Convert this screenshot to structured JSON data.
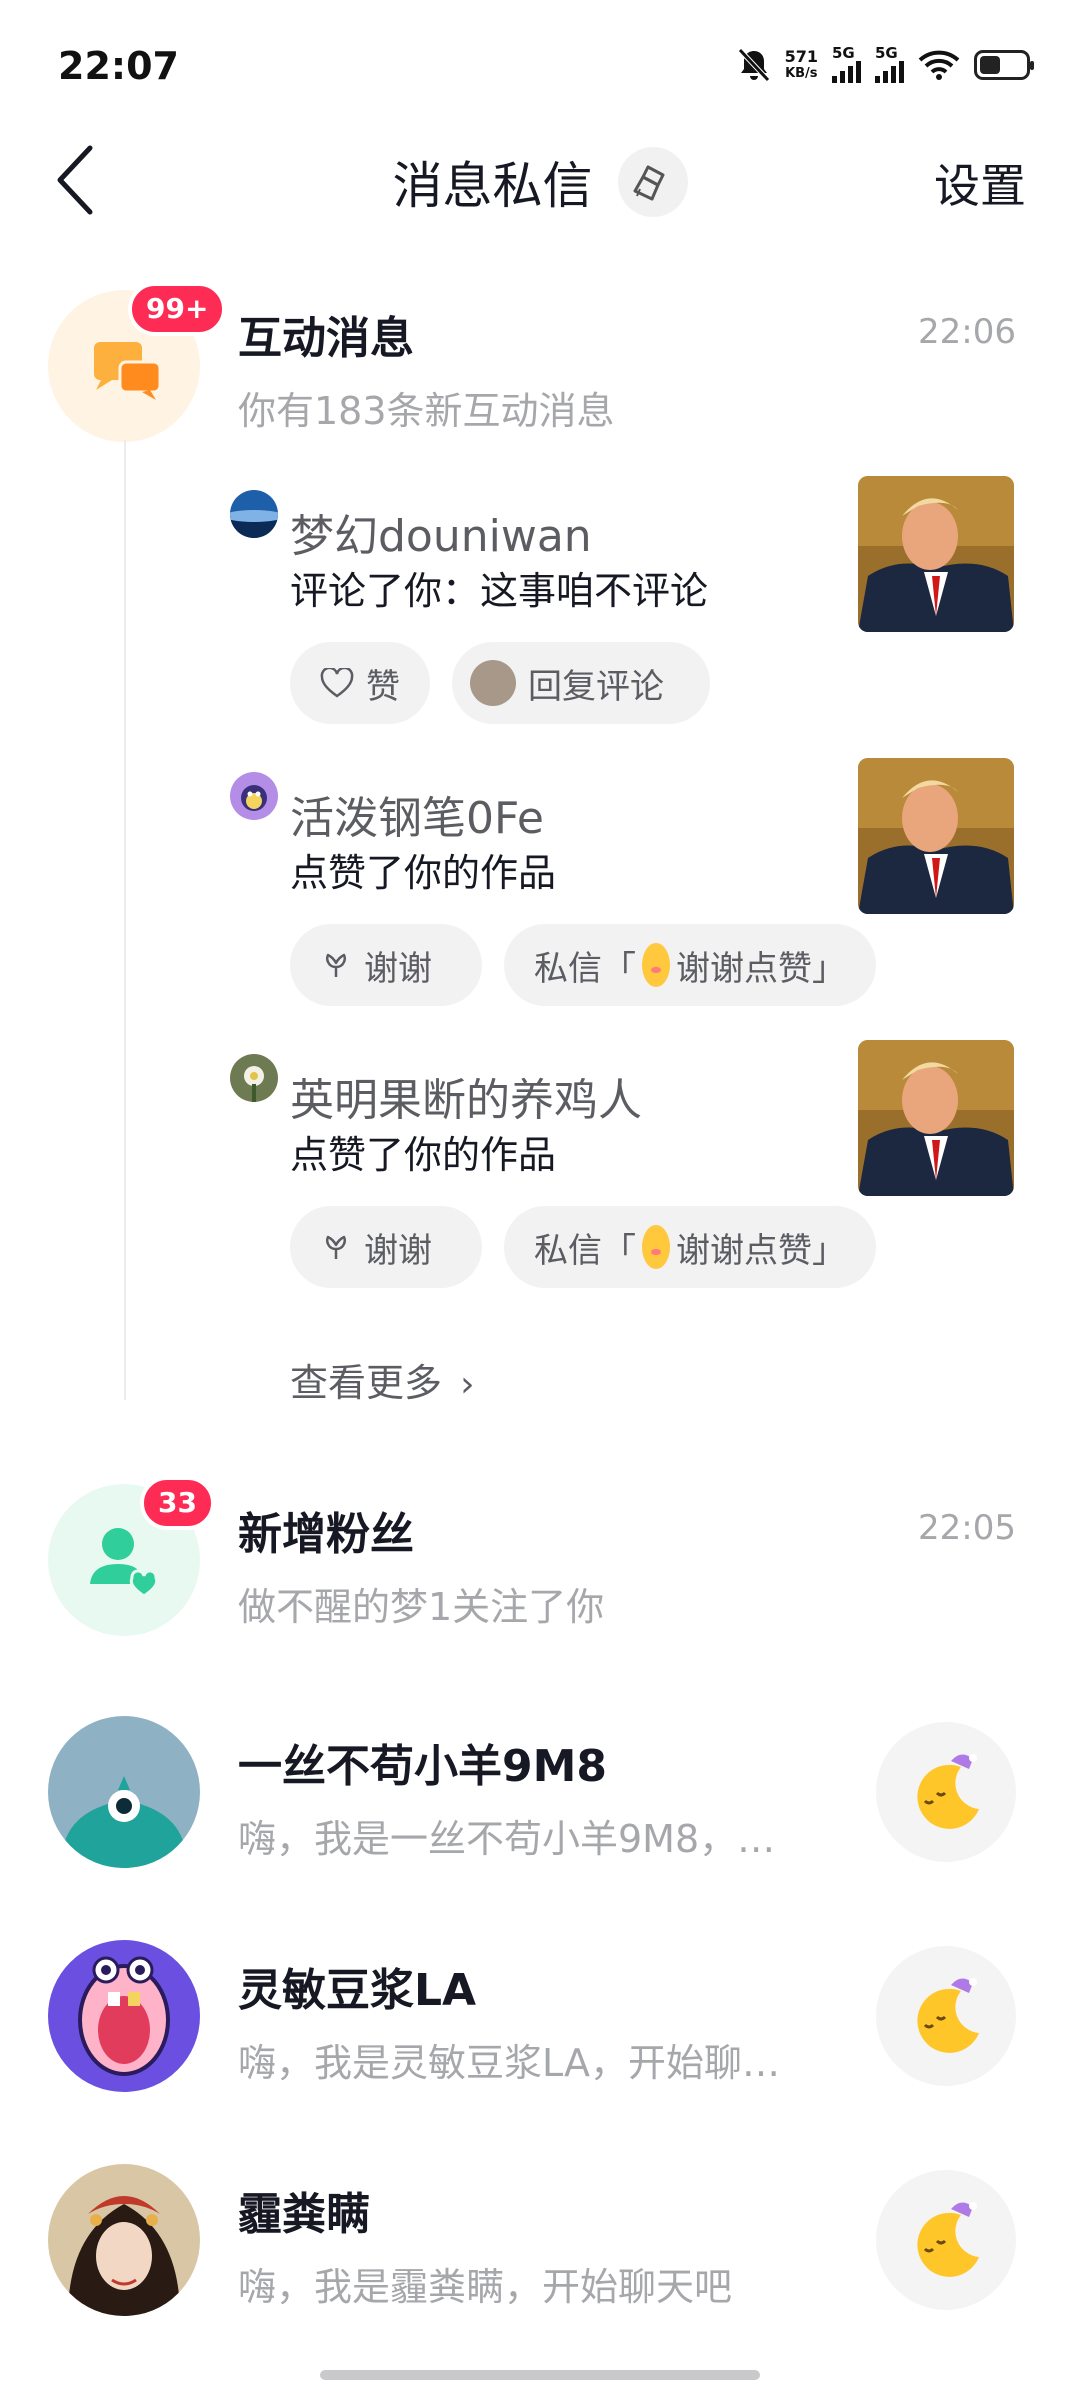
{
  "status_bar": {
    "time": "22:07",
    "net_speed_value": "571",
    "net_speed_unit": "KB/s",
    "sim1": "5G",
    "sim2": "5G",
    "icons": [
      "mute-bell-icon",
      "signal-icon",
      "signal-icon",
      "wifi-icon",
      "battery-icon"
    ]
  },
  "header": {
    "title": "消息私信",
    "settings_label": "设置"
  },
  "interaction": {
    "title": "互动消息",
    "subtitle": "你有183条新互动消息",
    "time": "22:06",
    "badge": "99+",
    "items": [
      {
        "name": "梦幻douniwan",
        "text": "评论了你：这事咱不评论",
        "actions": [
          "赞",
          "回复评论"
        ]
      },
      {
        "name": "活泼钢笔0Fe",
        "text": "点赞了你的作品",
        "actions": [
          "谢谢",
          "私信「",
          "谢谢点赞」"
        ]
      },
      {
        "name": "英明果断的养鸡人",
        "text": "点赞了你的作品",
        "actions": [
          "谢谢",
          "私信「",
          "谢谢点赞」"
        ]
      }
    ],
    "view_more": "查看更多"
  },
  "followers": {
    "title": "新增粉丝",
    "subtitle": "做不醒的梦1关注了你",
    "time": "22:05",
    "badge": "33"
  },
  "chats": [
    {
      "name": "一丝不苟小羊9M8",
      "preview": "嗨，我是一丝不苟小羊9M8，…"
    },
    {
      "name": "灵敏豆浆LA",
      "preview": "嗨，我是灵敏豆浆LA，开始聊…"
    },
    {
      "name": "霾粪瞒",
      "preview": "嗨，我是霾粪瞒，开始聊天吧"
    }
  ],
  "colors": {
    "accent_red": "#fe2c55",
    "interaction_orange": "#fdb03e",
    "follower_green": "#2fce9a"
  }
}
